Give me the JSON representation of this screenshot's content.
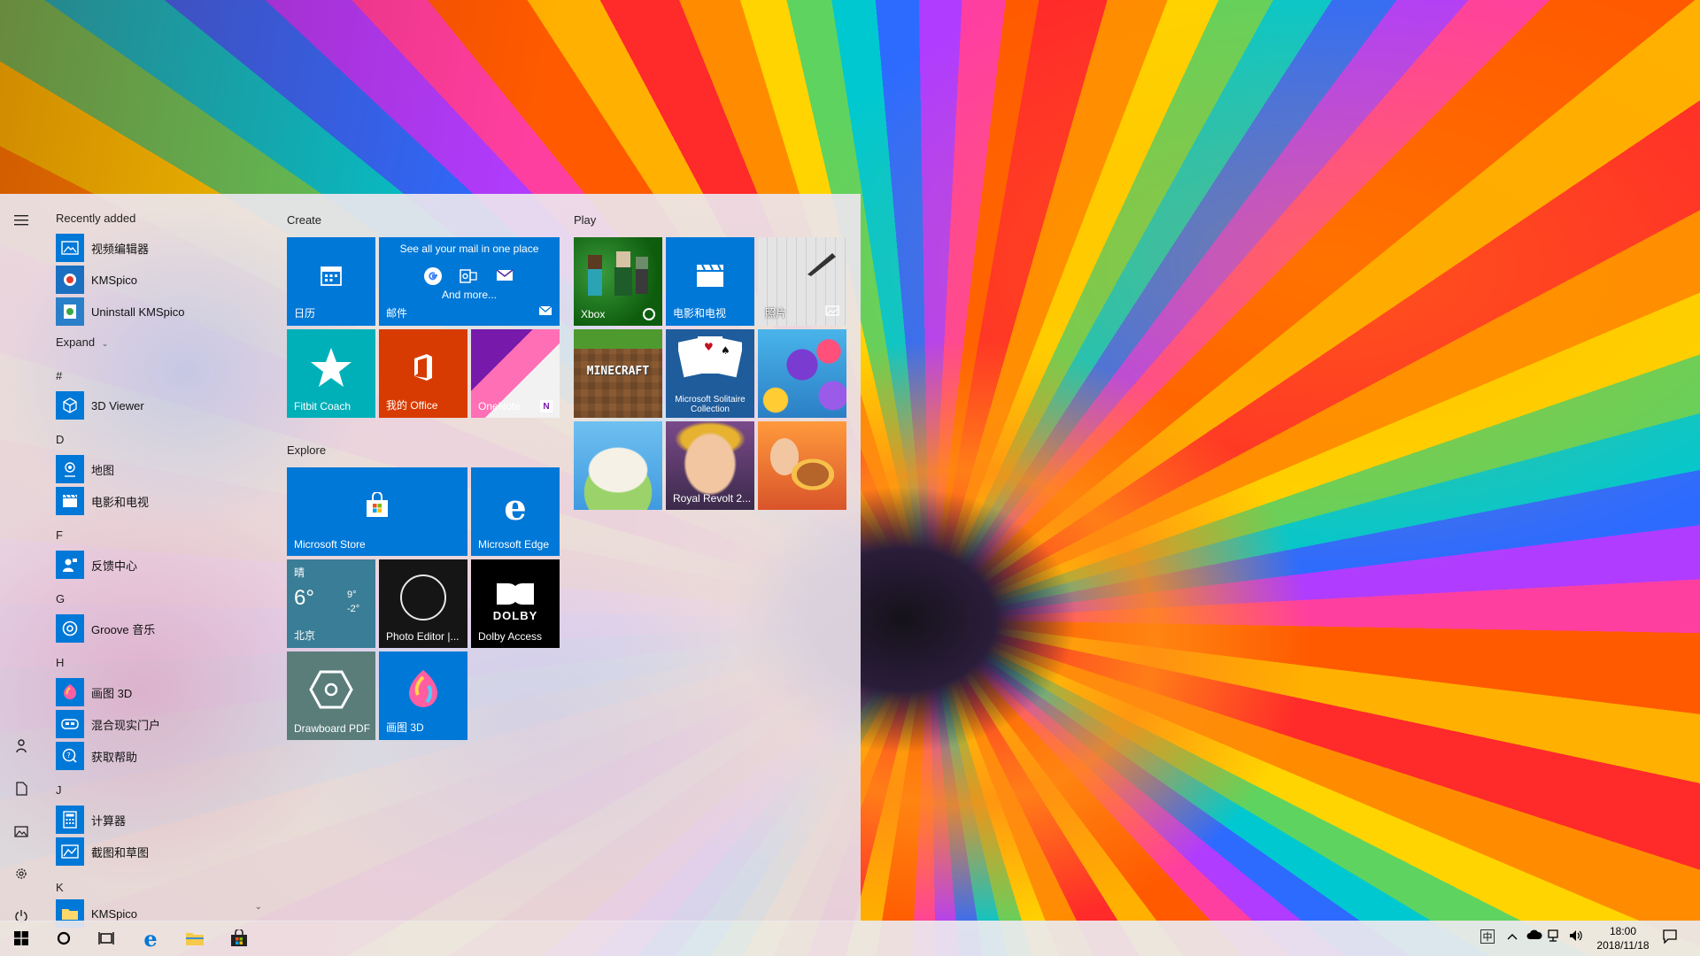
{
  "start_menu": {
    "sections": {
      "recently_added": "Recently added",
      "expand": "Expand",
      "hash": "#",
      "d": "D",
      "f": "F",
      "g": "G",
      "h": "H",
      "j": "J",
      "k": "K"
    },
    "recent_apps": [
      {
        "name": "视频编辑器",
        "icon": "video-editor-icon"
      },
      {
        "name": "KMSpico",
        "icon": "kmspico-icon"
      },
      {
        "name": "Uninstall KMSpico",
        "icon": "uninstall-icon"
      }
    ],
    "apps": {
      "viewer_3d": "3D Viewer",
      "maps": "地图",
      "movies": "电影和电视",
      "feedback": "反馈中心",
      "groove": "Groove 音乐",
      "paint3d": "画图 3D",
      "mixed_reality": "混合现实门户",
      "get_help": "获取帮助",
      "calculator": "计算器",
      "snip": "截图和草图",
      "kmspico": "KMSpico"
    },
    "groups": {
      "create": "Create",
      "explore": "Explore",
      "play": "Play"
    },
    "tiles": {
      "calendar": "日历",
      "mail": "邮件",
      "mail_promo": "See all your mail in one place",
      "mail_more": "And more...",
      "fitbit": "Fitbit Coach",
      "office": "我的 Office",
      "onenote": "OneNote",
      "store": "Microsoft Store",
      "edge": "Microsoft Edge",
      "weather_cond": "晴",
      "weather_temp": "6°",
      "weather_high": "9°",
      "weather_low": "-2°",
      "weather_city": "北京",
      "photo_editor": "Photo Editor |...",
      "dolby": "Dolby Access",
      "dolby_logo": "DOLBY",
      "drawboard": "Drawboard PDF",
      "paint3d": "画图 3D",
      "xbox": "Xbox",
      "movies_tile": "电影和电视",
      "photos": "照片",
      "minecraft": "MINECRAFT",
      "solitaire": "Microsoft Solitaire Collection",
      "royal_revolt": "Royal Revolt 2..."
    }
  },
  "taskbar": {
    "ime": "中",
    "time": "18:00",
    "date": "2018/11/18"
  },
  "colors": {
    "accent": "#0078d7",
    "xbox_green": "#107c10",
    "office_red": "#d83b01",
    "onenote_purple": "#7719aa",
    "fitbit_teal": "#00b0b9",
    "weather_teal": "#3a7d96",
    "drawboard_gray": "#5a7d7a"
  }
}
